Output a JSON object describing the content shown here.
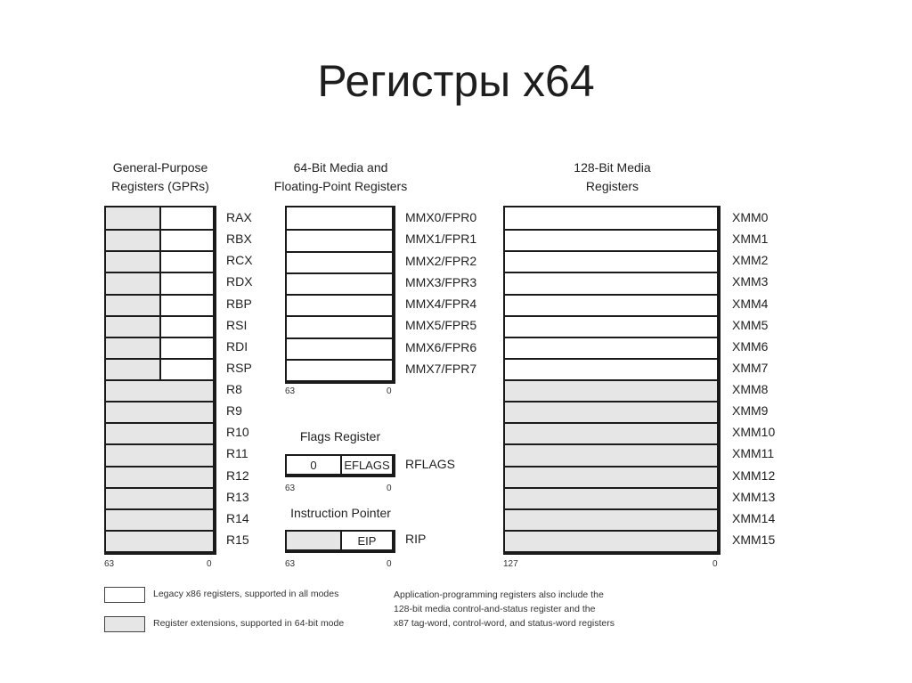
{
  "title": "Регистры x64",
  "colors": {
    "legacy": "#ffffff",
    "extension": "#e6e6e6",
    "border": "#1a1a1a"
  },
  "gpr": {
    "header": [
      "General-Purpose",
      "Registers (GPRs)"
    ],
    "registers": [
      {
        "name": "RAX",
        "type": "legacy-split"
      },
      {
        "name": "RBX",
        "type": "legacy-split"
      },
      {
        "name": "RCX",
        "type": "legacy-split"
      },
      {
        "name": "RDX",
        "type": "legacy-split"
      },
      {
        "name": "RBP",
        "type": "legacy-split"
      },
      {
        "name": "RSI",
        "type": "legacy-split"
      },
      {
        "name": "RDI",
        "type": "legacy-split"
      },
      {
        "name": "RSP",
        "type": "legacy-split"
      },
      {
        "name": "R8",
        "type": "extension"
      },
      {
        "name": "R9",
        "type": "extension"
      },
      {
        "name": "R10",
        "type": "extension"
      },
      {
        "name": "R11",
        "type": "extension"
      },
      {
        "name": "R12",
        "type": "extension"
      },
      {
        "name": "R13",
        "type": "extension"
      },
      {
        "name": "R14",
        "type": "extension"
      },
      {
        "name": "R15",
        "type": "extension"
      }
    ],
    "bit_high": "63",
    "bit_low": "0"
  },
  "mmx": {
    "header": [
      "64-Bit Media and",
      "Floating-Point Registers"
    ],
    "registers": [
      "MMX0/FPR0",
      "MMX1/FPR1",
      "MMX2/FPR2",
      "MMX3/FPR3",
      "MMX4/FPR4",
      "MMX5/FPR5",
      "MMX6/FPR6",
      "MMX7/FPR7"
    ],
    "bit_high": "63",
    "bit_low": "0"
  },
  "flags": {
    "header": "Flags Register",
    "upper": "0",
    "lower": "EFLAGS",
    "name": "RFLAGS",
    "bit_high": "63",
    "bit_low": "0"
  },
  "ip": {
    "header": "Instruction Pointer",
    "lower": "EIP",
    "name": "RIP",
    "bit_high": "63",
    "bit_low": "0"
  },
  "xmm": {
    "header": [
      "128-Bit Media",
      "Registers"
    ],
    "registers": [
      {
        "name": "XMM0",
        "type": "legacy"
      },
      {
        "name": "XMM1",
        "type": "legacy"
      },
      {
        "name": "XMM2",
        "type": "legacy"
      },
      {
        "name": "XMM3",
        "type": "legacy"
      },
      {
        "name": "XMM4",
        "type": "legacy"
      },
      {
        "name": "XMM5",
        "type": "legacy"
      },
      {
        "name": "XMM6",
        "type": "legacy"
      },
      {
        "name": "XMM7",
        "type": "legacy"
      },
      {
        "name": "XMM8",
        "type": "extension"
      },
      {
        "name": "XMM9",
        "type": "extension"
      },
      {
        "name": "XMM10",
        "type": "extension"
      },
      {
        "name": "XMM11",
        "type": "extension"
      },
      {
        "name": "XMM12",
        "type": "extension"
      },
      {
        "name": "XMM13",
        "type": "extension"
      },
      {
        "name": "XMM14",
        "type": "extension"
      },
      {
        "name": "XMM15",
        "type": "extension"
      }
    ],
    "bit_high": "127",
    "bit_low": "0"
  },
  "legend": {
    "legacy": "Legacy x86 registers, supported in all modes",
    "extension": "Register extensions, supported in 64-bit mode"
  },
  "note": [
    "Application-programming registers also include the",
    "128-bit media control-and-status register and the",
    "x87 tag-word, control-word, and status-word registers"
  ]
}
